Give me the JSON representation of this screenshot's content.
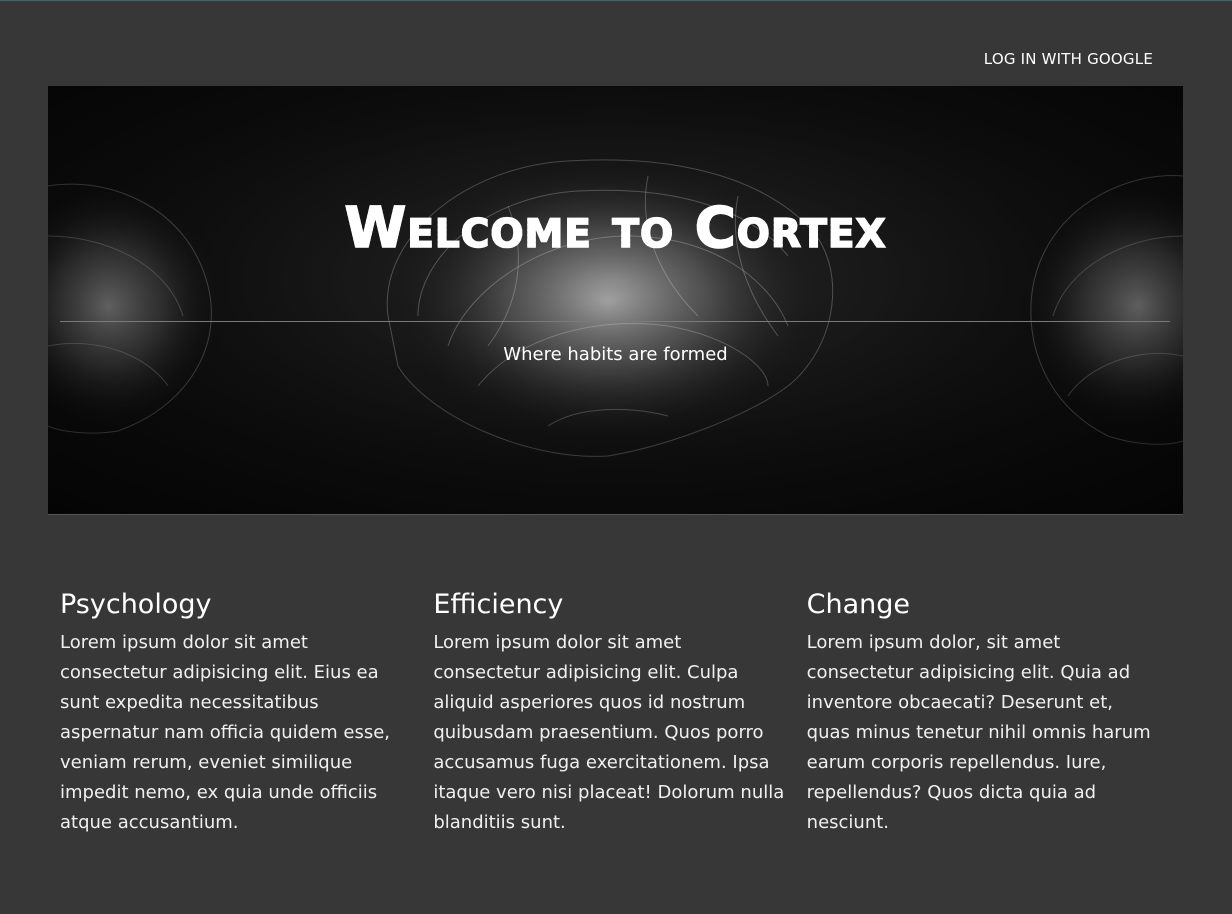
{
  "nav": {
    "login_label": "LOG IN WITH GOOGLE"
  },
  "hero": {
    "title": "Welcome to Cortex",
    "subtitle": "Where habits are formed",
    "background_image": "brain-xray-image"
  },
  "features": [
    {
      "title": "Psychology",
      "body": "Lorem ipsum dolor sit amet consectetur adipisicing elit. Eius ea sunt expedita necessitatibus aspernatur nam officia quidem esse, veniam rerum, eveniet similique impedit nemo, ex quia unde officiis atque accusantium."
    },
    {
      "title": "Efficiency",
      "body": "Lorem ipsum dolor sit amet consectetur adipisicing elit. Culpa aliquid asperiores quos id nostrum quibusdam praesentium. Quos porro accusamus fuga exercitationem. Ipsa itaque vero nisi placeat! Dolorum nulla blanditiis sunt."
    },
    {
      "title": "Change",
      "body": "Lorem ipsum dolor, sit amet consectetur adipisicing elit. Quia ad inventore obcaecati? Deserunt et, quas minus tenetur nihil omnis harum earum corporis repellendus. Iure, repellendus? Quos dicta quia ad nesciunt."
    }
  ],
  "colors": {
    "page_background": "#373737",
    "hero_background": "#111111",
    "text": "#ffffff"
  }
}
